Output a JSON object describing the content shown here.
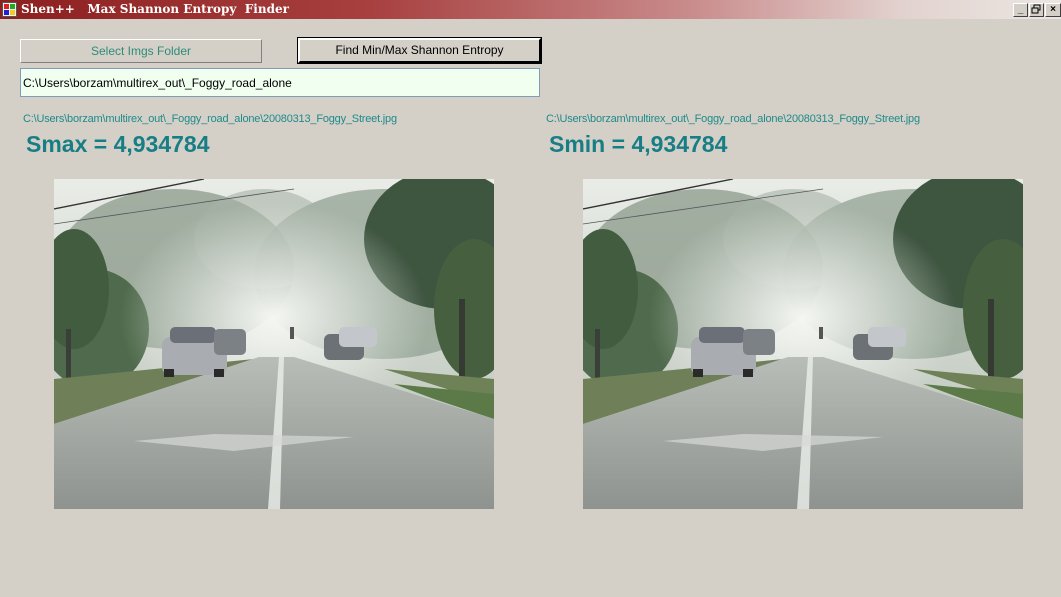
{
  "window": {
    "title": "Shen++   Max Shannon Entropy  Finder",
    "controls": {
      "minimize": "_",
      "restore": "🗗",
      "close": "×"
    }
  },
  "toolbar": {
    "select_folder_label": "Select Imgs Folder",
    "find_entropy_label": "Find Min/Max Shannon Entropy"
  },
  "folder_path": {
    "value": "C:\\Users\\borzam\\multirex_out\\_Foggy_road_alone"
  },
  "max_panel": {
    "file_path": "C:\\Users\\borzam\\multirex_out\\_Foggy_road_alone\\20080313_Foggy_Street.jpg",
    "entropy_label": "Smax = 4,934784",
    "image_alt": "Foggy street photo with maximum entropy"
  },
  "min_panel": {
    "file_path": "C:\\Users\\borzam\\multirex_out\\_Foggy_road_alone\\20080313_Foggy_Street.jpg",
    "entropy_label": "Smin = 4,934784",
    "image_alt": "Foggy street photo with minimum entropy"
  },
  "colors": {
    "titlebar_start": "#8c1f1f",
    "accent_text": "#177e86",
    "window_bg": "#d4d0c8",
    "input_bg": "#f0fff0"
  }
}
